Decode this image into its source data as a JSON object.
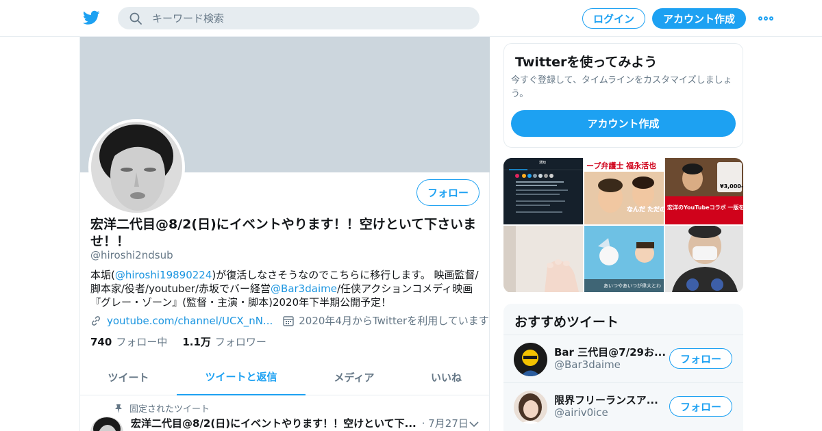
{
  "colors": {
    "accent": "#1da1f2",
    "link": "#1b95e0",
    "muted": "#657786",
    "banner": "#ccd6dd"
  },
  "header": {
    "search_placeholder": "キーワード検索",
    "login_label": "ログイン",
    "signup_label": "アカウント作成"
  },
  "profile": {
    "follow_label": "フォロー",
    "name": "宏洋二代目@8/2(日)にイベントやります！！空けといて下さいませ！！",
    "handle": "@hiroshi2ndsub",
    "bio_parts": {
      "p1": "本垢(",
      "link1": "@hiroshi19890224",
      "p2": ")が復活しなさそうなのでこちらに移行します。 映画監督/脚本家/役者/youtuber/赤坂でバー経営",
      "link2": "@Bar3daime",
      "p3": "/任侠アクションコメディ映画『グレー・ゾーン』(監督・主演・脚本)2020年下半期公開予定！"
    },
    "url": "youtube.com/channel/UCX_nN...",
    "joined": "2020年4月からTwitterを利用しています",
    "following_count": "740",
    "following_label": "フォロー中",
    "followers_count": "1.1万",
    "followers_label": "フォロワー"
  },
  "tabs": [
    {
      "label": "ツイート",
      "active": false
    },
    {
      "label": "ツイートと返信",
      "active": true
    },
    {
      "label": "メディア",
      "active": false
    },
    {
      "label": "いいね",
      "active": false
    }
  ],
  "pinned_tweet": {
    "pinned_label": "固定されたツイート",
    "author": "宏洋二代目@8/2(日)にイベントやります！！空けといて下...",
    "date": "· 7月27日"
  },
  "signup_card": {
    "title": "Twitterを使ってみよう",
    "description": "今すぐ登録して、タイムラインをカスタマイズしましょう。",
    "button_label": "アカウント作成"
  },
  "media_thumbs": [
    {
      "text": "通知",
      "icon": "notification-screenshot"
    },
    {
      "text": "ープ弁護士 福永活也",
      "icon": "video-thumb-lawyer"
    },
    {
      "text": "¥3,000-",
      "icon": "video-thumb-price"
    },
    {
      "text": "",
      "icon": "photo-foot"
    },
    {
      "text": "あいつやあいつが偉大とわ",
      "icon": "anime-thumb"
    },
    {
      "text": "",
      "icon": "photo-mask"
    }
  ],
  "media_overlay_texts": {
    "m2_sub": "なんだ ただの雑魚か",
    "m3_sub": "宏洋のYouTubeコラボ 一版を生で見られます！"
  },
  "recommended": {
    "title": "おすすめツイート",
    "items": [
      {
        "name": "Bar 三代目@7/29お...",
        "handle": "@Bar3daime",
        "follow_label": "フォロー"
      },
      {
        "name": "限界フリーランスア...",
        "handle": "@airiv0ice",
        "follow_label": "フォロー"
      }
    ]
  }
}
